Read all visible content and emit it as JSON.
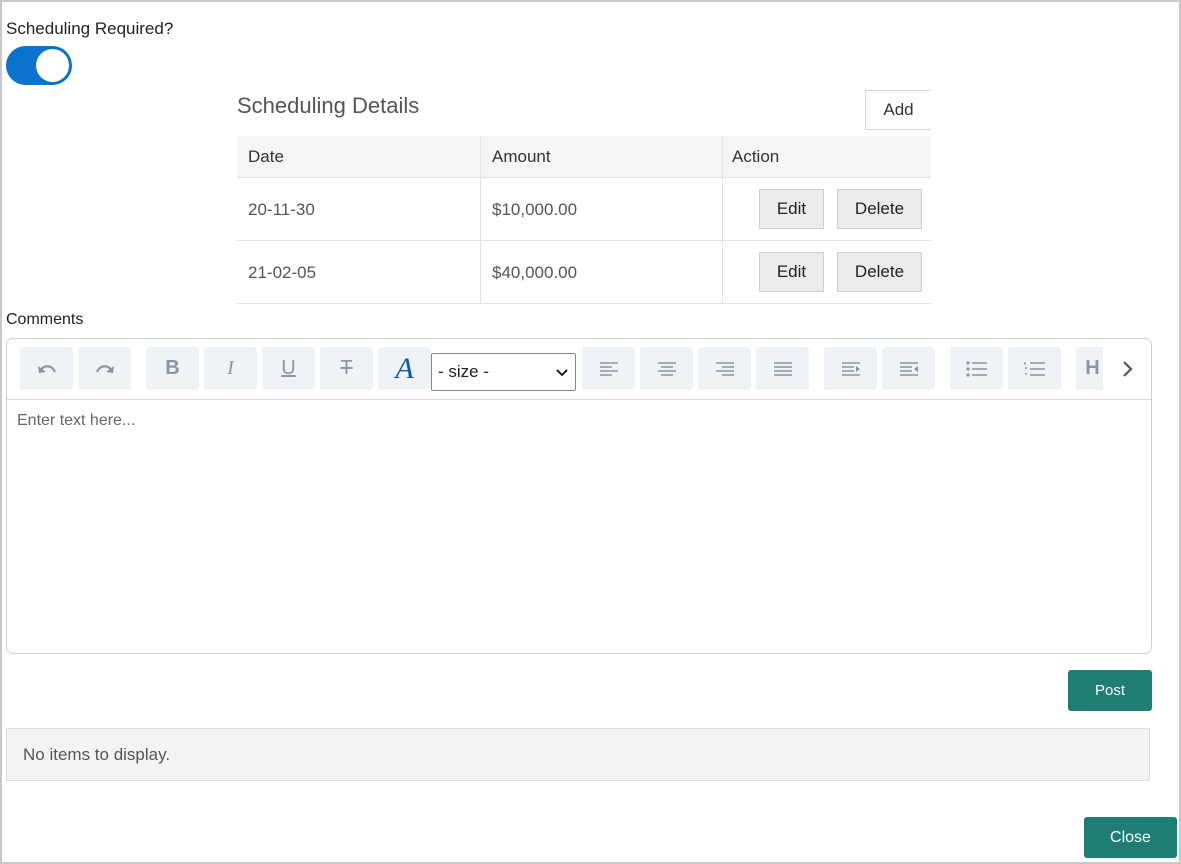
{
  "scheduling": {
    "required_label": "Scheduling Required?",
    "required_enabled": true,
    "title": "Scheduling Details",
    "add_label": "Add",
    "columns": [
      "Date",
      "Amount",
      "Action"
    ],
    "rows": [
      {
        "date": "20-11-30",
        "amount": "$10,000.00",
        "edit": "Edit",
        "delete": "Delete"
      },
      {
        "date": "21-02-05",
        "amount": "$40,000.00",
        "edit": "Edit",
        "delete": "Delete"
      }
    ]
  },
  "comments": {
    "label": "Comments",
    "size_select": "- size -",
    "placeholder": "Enter text here...",
    "toolbar": [
      "undo-icon",
      "redo-icon",
      "bold-icon",
      "italic-icon",
      "underline-icon",
      "strikethrough-icon",
      "font-color-icon",
      "size-select",
      "align-left-icon",
      "align-center-icon",
      "align-right-icon",
      "align-justify-icon",
      "indent-icon",
      "outdent-icon",
      "bullet-list-icon",
      "numbered-list-icon",
      "more-icon"
    ],
    "post_label": "Post",
    "empty_message": "No items to display."
  },
  "footer": {
    "close_label": "Close"
  },
  "colors": {
    "toggle_on": "#0b72cf",
    "primary_button": "#1f7e74"
  }
}
